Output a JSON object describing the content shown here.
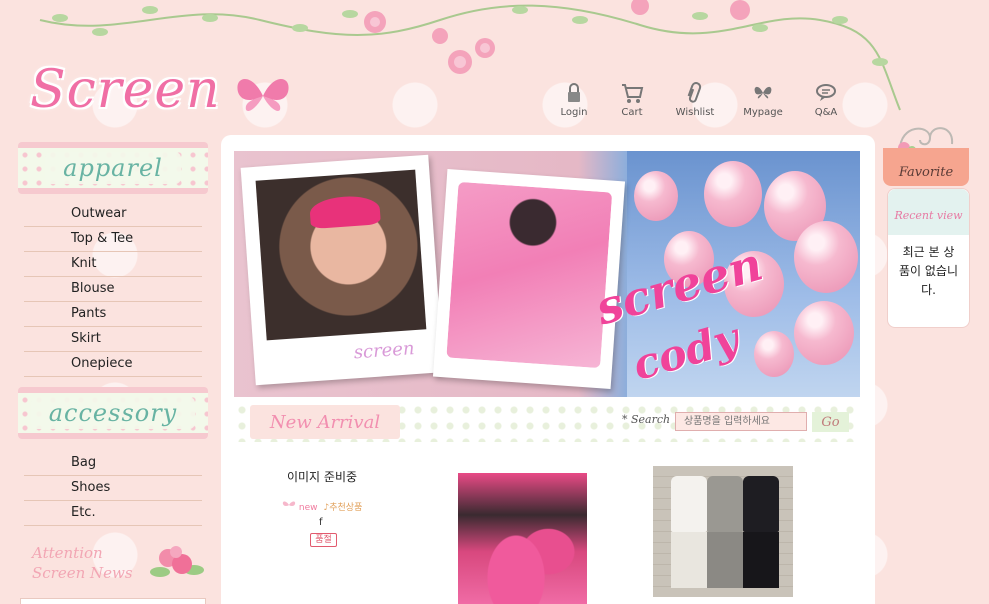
{
  "brand": {
    "logo_text": "Screen"
  },
  "topnav": {
    "items": [
      {
        "label": "Login",
        "icon": "lock-icon"
      },
      {
        "label": "Cart",
        "icon": "cart-icon"
      },
      {
        "label": "Wishlist",
        "icon": "paperclip-icon"
      },
      {
        "label": "Mypage",
        "icon": "butterfly-icon"
      },
      {
        "label": "Q&A",
        "icon": "speech-bubble-icon"
      }
    ]
  },
  "sidebar": {
    "apparel": {
      "title": "apparel",
      "items": [
        "Outwear",
        "Top & Tee",
        "Knit",
        "Blouse",
        "Pants",
        "Skirt",
        "Onepiece"
      ]
    },
    "accessory": {
      "title": "accessory",
      "items": [
        "Bag",
        "Shoes",
        "Etc."
      ]
    },
    "attention": {
      "line1": "Attention",
      "line2": "Screen News"
    }
  },
  "banner": {
    "caption": "screen",
    "text1": "screen",
    "text2": "cody"
  },
  "arrival": {
    "title": "New Arrival"
  },
  "search": {
    "label": "* Search",
    "placeholder": "상품명을 입력하세요",
    "button": "Go"
  },
  "products": [
    {
      "image_label": "이미지 준비중",
      "badge_new": "new",
      "badge_recommend": "추천상품",
      "name": "f",
      "status": "품절"
    }
  ],
  "right": {
    "favorite": "Favorite",
    "recent_title": "Recent view",
    "recent_empty": "최근 본 상품이 없습니다."
  },
  "colors": {
    "pink": "#f06fa5",
    "mint": "#68b3a3",
    "bg": "#fbe3df",
    "accent": "#f0439a"
  }
}
